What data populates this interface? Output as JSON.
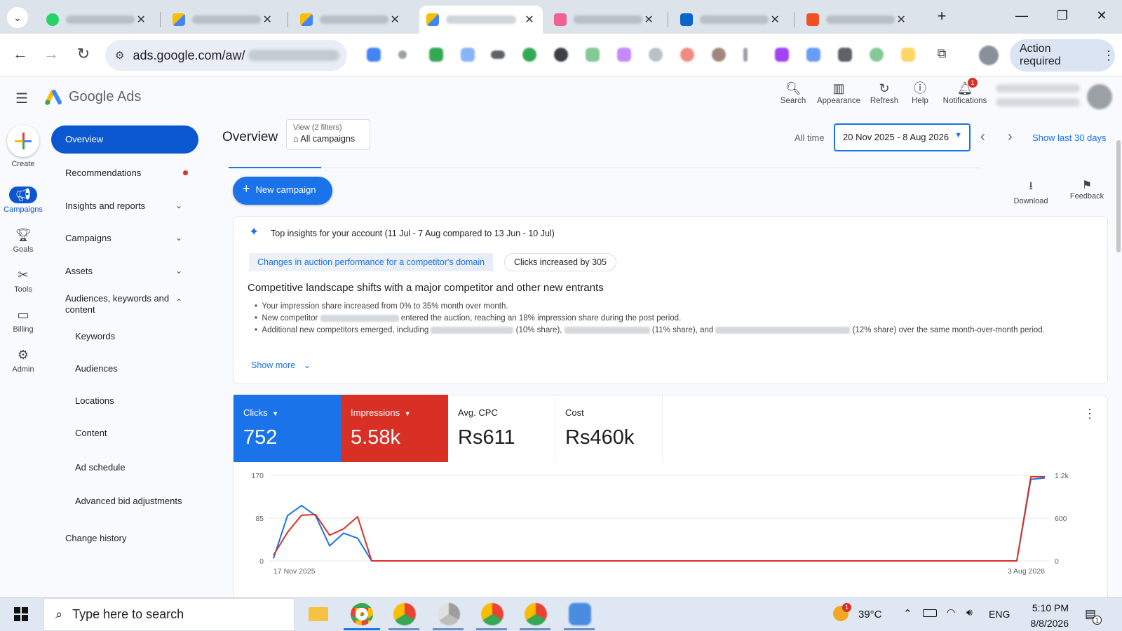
{
  "browser": {
    "tabs": [
      {
        "icon": "whatsapp-icon",
        "color": "#25d366"
      },
      {
        "icon": "google-ads-icon",
        "color": "#fbbc04"
      },
      {
        "icon": "google-ads-icon",
        "color": "#fbbc04"
      },
      {
        "icon": "google-ads-icon",
        "color": "#fbbc04",
        "active": true
      },
      {
        "icon": "app-icon",
        "color": "#f06292"
      },
      {
        "icon": "outlook-icon",
        "color": "#0a64c9"
      },
      {
        "icon": "powerpoint-icon",
        "color": "#f25022"
      }
    ],
    "new_tab": "+",
    "url": "ads.google.com/aw/",
    "action_required": "Action required"
  },
  "app": {
    "name": "Google Ads",
    "header_buttons": [
      {
        "label": "Search",
        "icon": "search-icon"
      },
      {
        "label": "Appearance",
        "icon": "appearance-icon"
      },
      {
        "label": "Refresh",
        "icon": "refresh-icon"
      },
      {
        "label": "Help",
        "icon": "help-icon"
      },
      {
        "label": "Notifications",
        "icon": "bell-icon",
        "badge": "1"
      }
    ]
  },
  "rail": {
    "create": "Create",
    "items": [
      {
        "label": "Campaigns",
        "icon": "megaphone-icon",
        "selected": true
      },
      {
        "label": "Goals",
        "icon": "trophy-icon"
      },
      {
        "label": "Tools",
        "icon": "tools-icon"
      },
      {
        "label": "Billing",
        "icon": "billing-icon"
      },
      {
        "label": "Admin",
        "icon": "gear-icon"
      }
    ]
  },
  "sidenav": {
    "overview": "Overview",
    "recommendations": "Recommendations",
    "insights": "Insights and reports",
    "campaigns": "Campaigns",
    "assets": "Assets",
    "audiences": "Audiences, keywords and content",
    "subitems": [
      "Keywords",
      "Audiences",
      "Locations",
      "Content",
      "Ad schedule",
      "Advanced bid adjustments"
    ],
    "change_history": "Change history"
  },
  "page": {
    "title": "Overview",
    "view_filter_label": "View (2 filters)",
    "view_filter_value": "All campaigns",
    "all_time": "All time",
    "date_range": "20 Nov 2025 - 8 Aug 2026",
    "show_last": "Show last 30 days",
    "new_campaign": "New campaign",
    "download": "Download",
    "feedback": "Feedback"
  },
  "insights": {
    "header": "Top insights for your account (11 Jul - 7 Aug compared to 13 Jun - 10 Jul)",
    "chip1": "Changes in auction performance for a competitor's domain",
    "chip2": "Clicks increased by 305",
    "headline": "Competitive landscape shifts with a major competitor and other new entrants",
    "bullet1": "Your impression share increased from 0% to 35% month over month.",
    "bullet2_a": "New competitor",
    "bullet2_b": "entered the auction, reaching an 18% impression share during the post period.",
    "bullet3_a": "Additional new competitors emerged, including",
    "bullet3_b": "(10% share),",
    "bullet3_c": "(11% share), and",
    "bullet3_d": "(12% share) over the same month-over-month period.",
    "show_more": "Show more"
  },
  "metrics": [
    {
      "label": "Clicks",
      "value": "752",
      "color": "#1a73e8",
      "dropdown": true
    },
    {
      "label": "Impressions",
      "value": "5.58k",
      "color": "#d93025",
      "dropdown": true
    },
    {
      "label": "Avg. CPC",
      "value": "Rs611"
    },
    {
      "label": "Cost",
      "value": "Rs460k"
    }
  ],
  "chart_data": {
    "type": "line",
    "x_start_label": "17 Nov 2025",
    "x_end_label": "3 Aug 2026",
    "left_ticks": [
      "170",
      "85",
      "0"
    ],
    "right_ticks": [
      "1.2k",
      "600",
      "0"
    ],
    "ylim_left": [
      0,
      170
    ],
    "ylim_right": [
      0,
      1200
    ],
    "series": [
      {
        "name": "Clicks",
        "color": "#1a73e8",
        "axis": "left",
        "values": [
          5,
          90,
          110,
          90,
          30,
          55,
          45,
          0,
          0,
          0,
          0,
          0,
          0,
          0,
          0,
          0,
          0,
          0,
          0,
          0,
          0,
          0,
          0,
          0,
          0,
          0,
          0,
          0,
          0,
          0,
          0,
          0,
          0,
          0,
          0,
          0,
          0,
          0,
          0,
          0,
          0,
          0,
          0,
          0,
          0,
          0,
          0,
          0,
          0,
          0,
          0,
          0,
          0,
          0,
          162,
          165
        ]
      },
      {
        "name": "Impressions",
        "color": "#d93025",
        "axis": "right",
        "values": [
          80,
          400,
          640,
          650,
          360,
          450,
          620,
          0,
          0,
          0,
          0,
          0,
          0,
          0,
          0,
          0,
          0,
          0,
          0,
          0,
          0,
          0,
          0,
          0,
          0,
          0,
          0,
          0,
          0,
          0,
          0,
          0,
          0,
          0,
          0,
          0,
          0,
          0,
          0,
          0,
          0,
          0,
          0,
          0,
          0,
          0,
          0,
          0,
          0,
          0,
          0,
          0,
          0,
          0,
          1180,
          1180
        ]
      }
    ]
  },
  "taskbar": {
    "search_placeholder": "Type here to search",
    "temperature": "39°C",
    "lang": "ENG",
    "time": "5:10 PM",
    "date": "8/8/2026",
    "weather_badge": "1",
    "notif_badge": "1"
  }
}
